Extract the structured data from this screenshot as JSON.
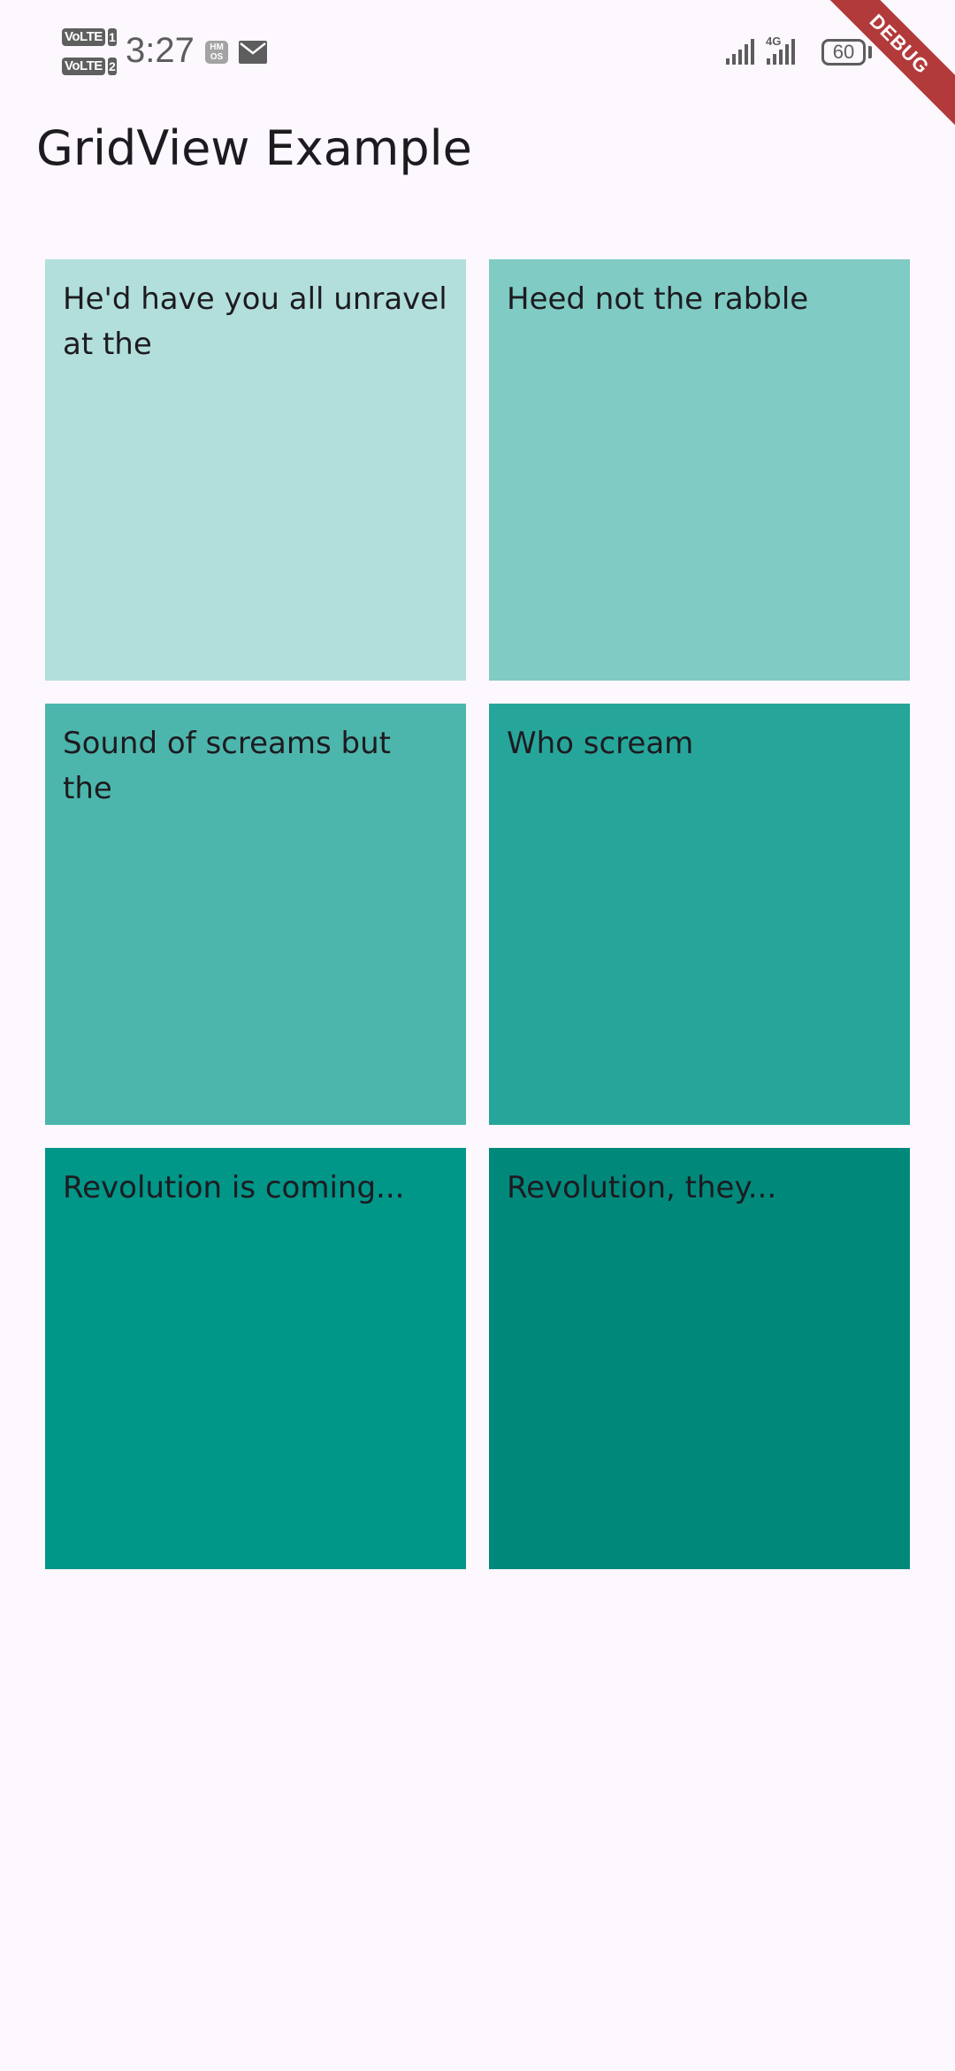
{
  "status_bar": {
    "volte_label": "VoLTE",
    "sim_1": "1",
    "sim_2": "2",
    "time": "3:27",
    "hmos_label": "HM OS",
    "network_type": "4G",
    "battery_level": "60",
    "icons": [
      "envelope-icon",
      "signal-icon",
      "battery-icon"
    ]
  },
  "debug_banner": {
    "label": "DEBUG",
    "color": "#b23a3a"
  },
  "app_bar": {
    "title": "GridView Example"
  },
  "grid": {
    "items": [
      {
        "text": "He'd have you all unravel at the",
        "color": "#b2dfdb"
      },
      {
        "text": "Heed not the rabble",
        "color": "#80cbc4"
      },
      {
        "text": "Sound of screams but the",
        "color": "#4db6ac"
      },
      {
        "text": "Who scream",
        "color": "#26a69a"
      },
      {
        "text": "Revolution is coming...",
        "color": "#009688"
      },
      {
        "text": "Revolution, they...",
        "color": "#00897b"
      }
    ]
  }
}
